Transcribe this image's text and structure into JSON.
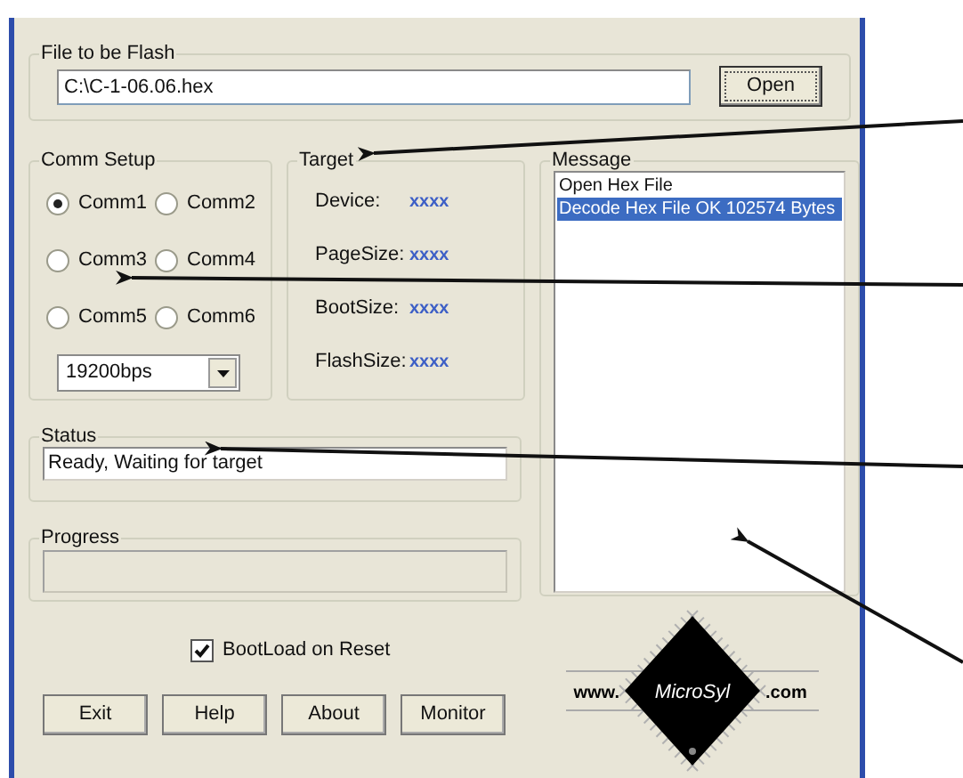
{
  "file_group": {
    "legend": "File to be Flash",
    "path": "C:\\C-1-06.06.hex",
    "open_button": "Open"
  },
  "comm_setup": {
    "legend": "Comm Setup",
    "ports": [
      {
        "label": "Comm1",
        "selected": true
      },
      {
        "label": "Comm2",
        "selected": false
      },
      {
        "label": "Comm3",
        "selected": false
      },
      {
        "label": "Comm4",
        "selected": false
      },
      {
        "label": "Comm5",
        "selected": false
      },
      {
        "label": "Comm6",
        "selected": false
      }
    ],
    "baud": "19200bps"
  },
  "target": {
    "legend": "Target",
    "fields": [
      {
        "label": "Device:",
        "value": "xxxx"
      },
      {
        "label": "PageSize:",
        "value": "xxxx"
      },
      {
        "label": "BootSize:",
        "value": "xxxx"
      },
      {
        "label": "FlashSize:",
        "value": "xxxx"
      }
    ]
  },
  "message": {
    "legend": "Message",
    "items": [
      {
        "text": "Open Hex File",
        "selected": false
      },
      {
        "text": "Decode Hex File OK 102574 Bytes",
        "selected": true
      }
    ]
  },
  "status": {
    "legend": "Status",
    "text": "Ready, Waiting for target"
  },
  "progress": {
    "legend": "Progress"
  },
  "bootload": {
    "label": "BootLoad on Reset",
    "checked": true
  },
  "buttons": [
    "Exit",
    "Help",
    "About",
    "Monitor"
  ],
  "logo": {
    "prefix": "www.",
    "name": "MicroSyl",
    "suffix": ".com"
  }
}
